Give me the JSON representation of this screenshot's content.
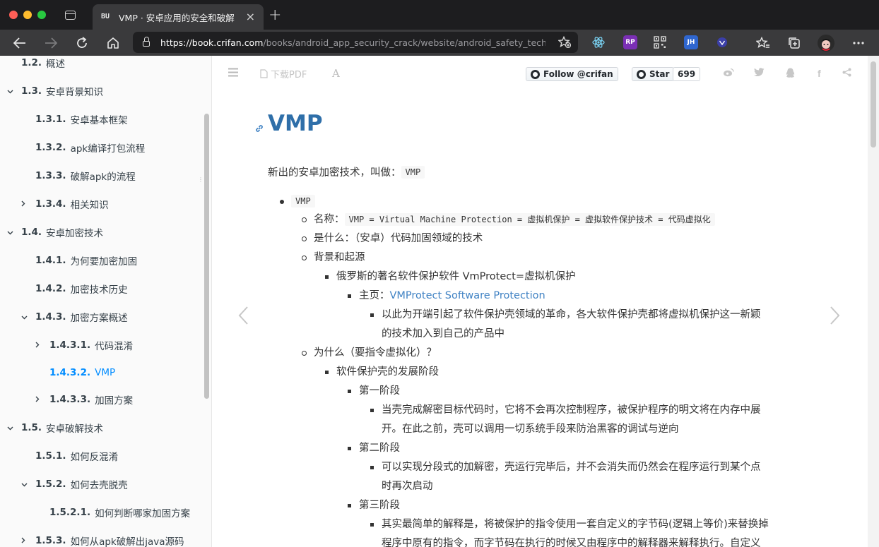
{
  "browser": {
    "tab_title": "VMP · 安卓应用的安全和破解",
    "tab_favicon": "BU",
    "url_host": "https://book.crifan.com",
    "url_path": "/books/android_app_security_crack/website/android_safety_tech/encr...",
    "colors": {
      "close": "#ff5f57",
      "minimize": "#febc2e",
      "zoom": "#28c840"
    },
    "extensions": [
      {
        "name": "react-devtools-icon",
        "label": "",
        "color": "#3a3a3c"
      },
      {
        "name": "rp-extension-icon",
        "label": "RP",
        "color": "#7b2fb5"
      },
      {
        "name": "qr-code-icon",
        "label": "",
        "color": "#3a3a3c"
      },
      {
        "name": "jh-extension-icon",
        "label": "JH",
        "color": "#2f66cf"
      },
      {
        "name": "vue-devtools-icon",
        "label": "",
        "color": "#3b3fa8"
      }
    ]
  },
  "toc": [
    {
      "num": "1.2.",
      "label": "概述",
      "expand": "none",
      "active": false
    },
    {
      "num": "1.3.",
      "label": "安卓背景知识",
      "expand": "open",
      "active": false
    },
    {
      "num": "1.3.1.",
      "label": "安卓基本框架",
      "expand": "none",
      "active": false
    },
    {
      "num": "1.3.2.",
      "label": "apk编译打包流程",
      "expand": "none",
      "active": false
    },
    {
      "num": "1.3.3.",
      "label": "破解apk的流程",
      "expand": "none",
      "active": false
    },
    {
      "num": "1.3.4.",
      "label": "相关知识",
      "expand": "closed",
      "active": false
    },
    {
      "num": "1.4.",
      "label": "安卓加密技术",
      "expand": "open",
      "active": false
    },
    {
      "num": "1.4.1.",
      "label": "为何要加密加固",
      "expand": "none",
      "active": false
    },
    {
      "num": "1.4.2.",
      "label": "加密技术历史",
      "expand": "none",
      "active": false
    },
    {
      "num": "1.4.3.",
      "label": "加密方案概述",
      "expand": "open",
      "active": false
    },
    {
      "num": "1.4.3.1.",
      "label": "代码混淆",
      "expand": "closed",
      "active": false
    },
    {
      "num": "1.4.3.2.",
      "label": "VMP",
      "expand": "none",
      "active": true
    },
    {
      "num": "1.4.3.3.",
      "label": "加固方案",
      "expand": "closed",
      "active": false
    },
    {
      "num": "1.5.",
      "label": "安卓破解技术",
      "expand": "open",
      "active": false
    },
    {
      "num": "1.5.1.",
      "label": "如何反混淆",
      "expand": "none",
      "active": false
    },
    {
      "num": "1.5.2.",
      "label": "如何去壳脱壳",
      "expand": "open",
      "active": false
    },
    {
      "num": "1.5.2.1.",
      "label": "如何判断哪家加固方案",
      "expand": "none",
      "active": false
    },
    {
      "num": "1.5.3.",
      "label": "如何从apk破解出java源码",
      "expand": "closed",
      "active": false
    }
  ],
  "header": {
    "pdf_label": "下载PDF",
    "follow_label": "Follow @crifan",
    "star_label": "Star",
    "star_count": "699"
  },
  "article": {
    "title": "VMP",
    "intro_text": "新出的安卓加密技术，叫做：",
    "intro_code": "VMP",
    "top_code": "VMP",
    "name_label": "名称：",
    "name_code": "VMP = Virtual Machine Protection = 虚拟机保护 = 虚拟软件保护技术 = 代码虚拟化",
    "what": "是什么：（安卓）代码加固领域的技术",
    "background": "背景和起源",
    "russia": "俄罗斯的著名软件保护软件 VmProtect=虚拟机保护",
    "homepage_label": "主页：",
    "homepage_link": "VMProtect Software Protection",
    "revolution_1": "以此为开端引起了软件保护壳领域的革命，各大软件保护壳都将虚拟机保护这一新颖",
    "revolution_2": "的技术加入到自己的产品中",
    "why": "为什么（要指令虚拟化）？",
    "stages": "软件保护壳的发展阶段",
    "stage1": "第一阶段",
    "stage1_text_1": "当壳完成解密目标代码时，它将不会再次控制程序，被保护程序的明文将在内存中展",
    "stage1_text_2": "开。在此之前，壳可以调用一切系统手段来防治黑客的调试与逆向",
    "stage2": "第二阶段",
    "stage2_text_1": "可以实现分段式的加解密，壳运行完毕后，并不会消失而仍然会在程序运行到某个点",
    "stage2_text_2": "时再次启动",
    "stage3": "第三阶段",
    "stage3_text_1": "其实最简单的解释是，将被保护的指令使用一套自定义的字节码(逻辑上等价)来替换掉",
    "stage3_text_2": "程序中原有的指令，而字节码在执行的时候又由程序中的解释器来解释执行。自定义"
  }
}
